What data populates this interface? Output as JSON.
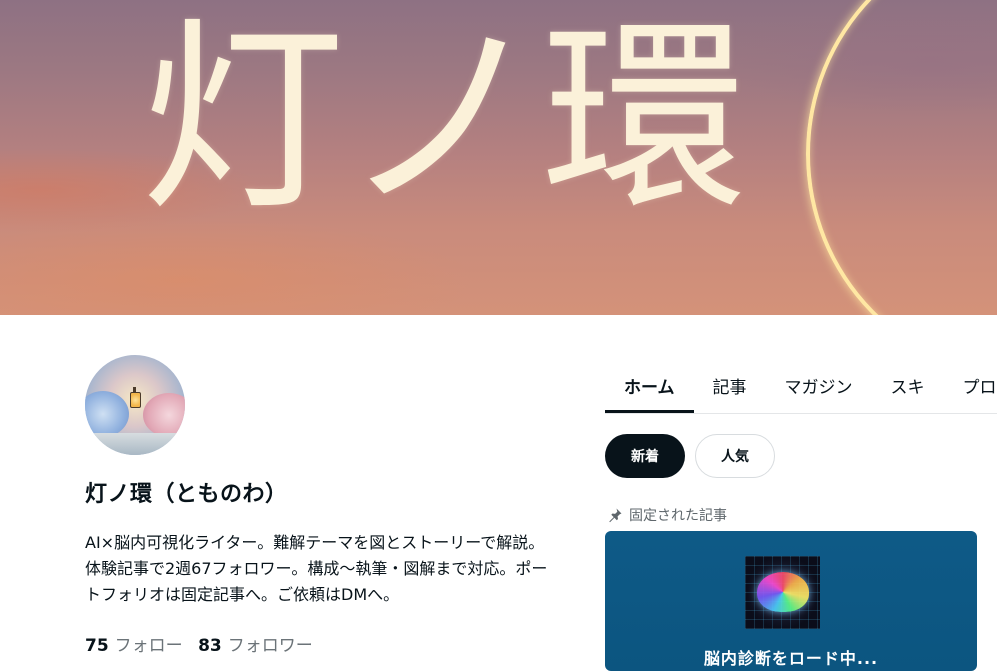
{
  "banner": {
    "title": "灯ノ環"
  },
  "profile": {
    "name": "灯ノ環（とものわ）",
    "bio": "AI×脳内可視化ライター。難解テーマを図とストーリーで解説。体験記事で2週67フォロワー。構成〜執筆・図解まで対応。ポートフォリオは固定記事へ。ご依頼はDMへ。",
    "following_count": "75",
    "following_label": "フォロー",
    "followers_count": "83",
    "followers_label": "フォロワー"
  },
  "tabs": [
    {
      "label": "ホーム",
      "active": true
    },
    {
      "label": "記事"
    },
    {
      "label": "マガジン"
    },
    {
      "label": "スキ"
    },
    {
      "label": "プロフィール"
    }
  ],
  "filters": {
    "new": "新着",
    "popular": "人気"
  },
  "pinned": {
    "label": "固定された記事",
    "icon": "pin-icon",
    "article_title": "脳内診断をロード中..."
  },
  "colors": {
    "text": "#08131a",
    "muted": "#6b7378",
    "active_chip": "#08131a",
    "card_bg": "#0e5a87",
    "banner_text": "#fbf1d9",
    "ring": "#ffe7a3"
  }
}
